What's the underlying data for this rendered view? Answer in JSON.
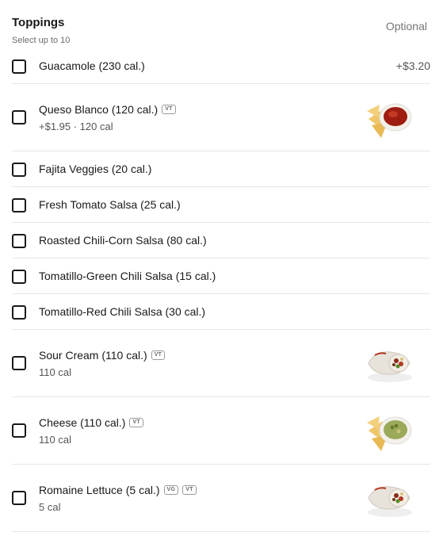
{
  "section": {
    "title": "Toppings",
    "subtitle": "Select up to 10",
    "optional_label": "Optional"
  },
  "items": [
    {
      "name": "Guacamole (230 cal.)",
      "price": "+$3.20"
    },
    {
      "name": "Queso Blanco (120 cal.)",
      "badges": [
        "VT"
      ],
      "detail": "+$1.95 · 120 cal",
      "image": "queso-chips-icon"
    },
    {
      "name": "Fajita Veggies (20 cal.)"
    },
    {
      "name": "Fresh Tomato Salsa (25 cal.)"
    },
    {
      "name": "Roasted Chili-Corn Salsa (80 cal.)"
    },
    {
      "name": "Tomatillo-Green Chili Salsa (15 cal.)"
    },
    {
      "name": "Tomatillo-Red Chili Salsa (30 cal.)"
    },
    {
      "name": "Sour Cream (110 cal.)",
      "badges": [
        "VT"
      ],
      "detail": "110 cal",
      "image": "burrito-icon"
    },
    {
      "name": "Cheese (110 cal.)",
      "badges": [
        "VT"
      ],
      "detail": "110 cal",
      "image": "chips-guac-icon"
    },
    {
      "name": "Romaine Lettuce (5 cal.)",
      "badges": [
        "VG",
        "VT"
      ],
      "detail": "5 cal",
      "image": "burrito-icon"
    }
  ]
}
